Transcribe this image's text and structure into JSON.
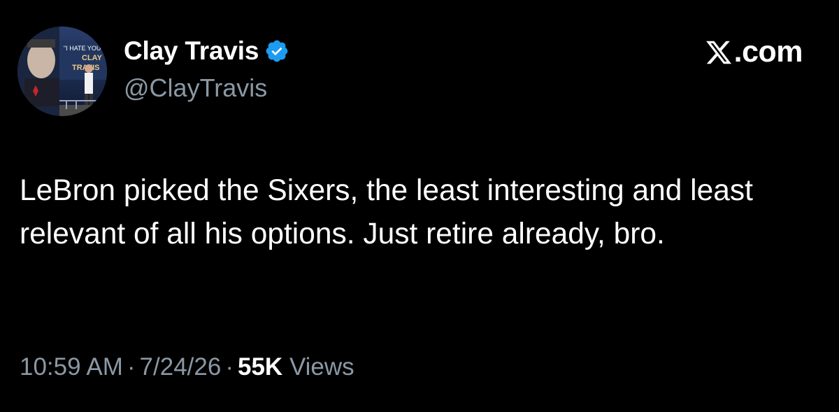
{
  "author": {
    "display_name": "Clay Travis",
    "handle": "@ClayTravis",
    "verified_icon": "verified-badge-icon",
    "verified_color": "#1d9bf0",
    "avatar_sign_text": [
      "\"I HATE YOU",
      "CLAY",
      "TRAVIS"
    ]
  },
  "brand": {
    "icon": "x-logo-icon",
    "label": ".com"
  },
  "tweet": {
    "text": "LeBron picked the Sixers, the least interesting and least relevant of all his options. Just retire already, bro."
  },
  "meta": {
    "time": "10:59 AM",
    "separator": "·",
    "date": "7/24/26",
    "views_count": "55K",
    "views_label": "Views"
  },
  "colors": {
    "background": "#000000",
    "primary_text": "#ffffff",
    "secondary_text": "#8b98a5"
  }
}
